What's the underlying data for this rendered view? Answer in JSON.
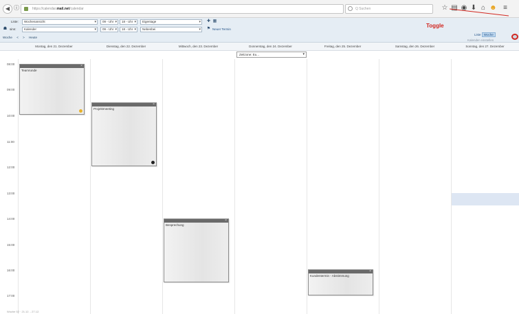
{
  "browser": {
    "url_prefix": "https://calendar.",
    "url_domain": "mail.net",
    "url_suffix": "/calendar",
    "search_placeholder": "Q Suchen",
    "toolbar_icons": [
      "star-icon",
      "bookmark-icon",
      "shield-icon",
      "download-icon",
      "home-icon",
      "smiley-icon",
      "menu-icon"
    ]
  },
  "toolbar": {
    "row1": {
      "view_label": "Liste:",
      "calendar_select": "Wochenansicht",
      "from_select": "09 - Uhr",
      "to_select": "18 - Uhr",
      "type_select": "Eigentage"
    },
    "row2": {
      "user_label": "sinn:",
      "user_select": "Kalender",
      "start_select": "09 - Uhr",
      "end_select": "18 - Uhr",
      "group_select": "Nebenbei",
      "add_link": "Neuer Termin"
    },
    "week_nav": [
      "Woche",
      "<",
      ">",
      "Heute"
    ],
    "settings_link": "Kalender einstellen",
    "right_controls": {
      "list_label": "Liste",
      "week_label": "Woche"
    },
    "toggle_annotation": "Toggle"
  },
  "calendar": {
    "timezone_select": "Zeitzone: Eu...",
    "days": [
      "Montag, den 21. Dezember",
      "Dienstag, den 22. Dezember",
      "Mittwoch, den 23. Dezember",
      "Donnerstag, den 24. Dezember",
      "Freitag, den 25. Dezember",
      "Samstag, den 26. Dezember",
      "Sonntag, den 27. Dezember"
    ],
    "times": [
      "08:00",
      "09:00",
      "10:00",
      "11:00",
      "12:00",
      "13:00",
      "14:00",
      "15:00",
      "16:00",
      "17:00",
      "18:00"
    ],
    "events": [
      {
        "title": "Teamrunde",
        "mark_color": "#e8b22a"
      },
      {
        "title": "Projektmeeting",
        "mark_color": "#222222"
      },
      {
        "title": "Besprechung",
        "mark_color": ""
      },
      {
        "title": "Kundentermin - Abstimmung",
        "mark_color": ""
      }
    ],
    "footer_text": "Woche 52 · 21.12. - 27.12."
  },
  "colors": {
    "toolbar_bg": "#e5edf4",
    "event_head": "#6a6a6a",
    "annotation_red": "#d1261f",
    "highlight": "#dde6f3"
  }
}
